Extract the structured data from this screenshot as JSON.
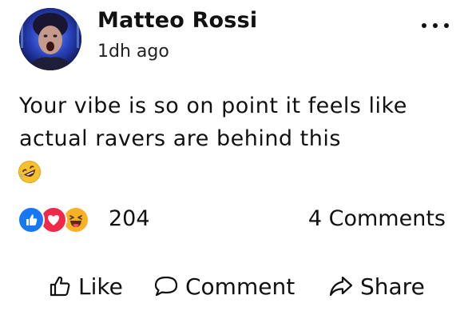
{
  "post": {
    "author": "Matteo Rossi",
    "timestamp": "1dh ago",
    "text": "Your vibe is so on point it feels like actual ravers are behind this",
    "emoji": "rolling-on-floor-laughing"
  },
  "reactions": {
    "types": [
      "like",
      "love",
      "haha"
    ],
    "count": "204"
  },
  "comments": {
    "label": "4 Comments"
  },
  "actions": {
    "like_label": "Like",
    "comment_label": "Comment",
    "share_label": "Share"
  },
  "colors": {
    "like": "#1877f2",
    "love": "#f0284a",
    "haha": "#f7b125",
    "text": "#111111"
  }
}
